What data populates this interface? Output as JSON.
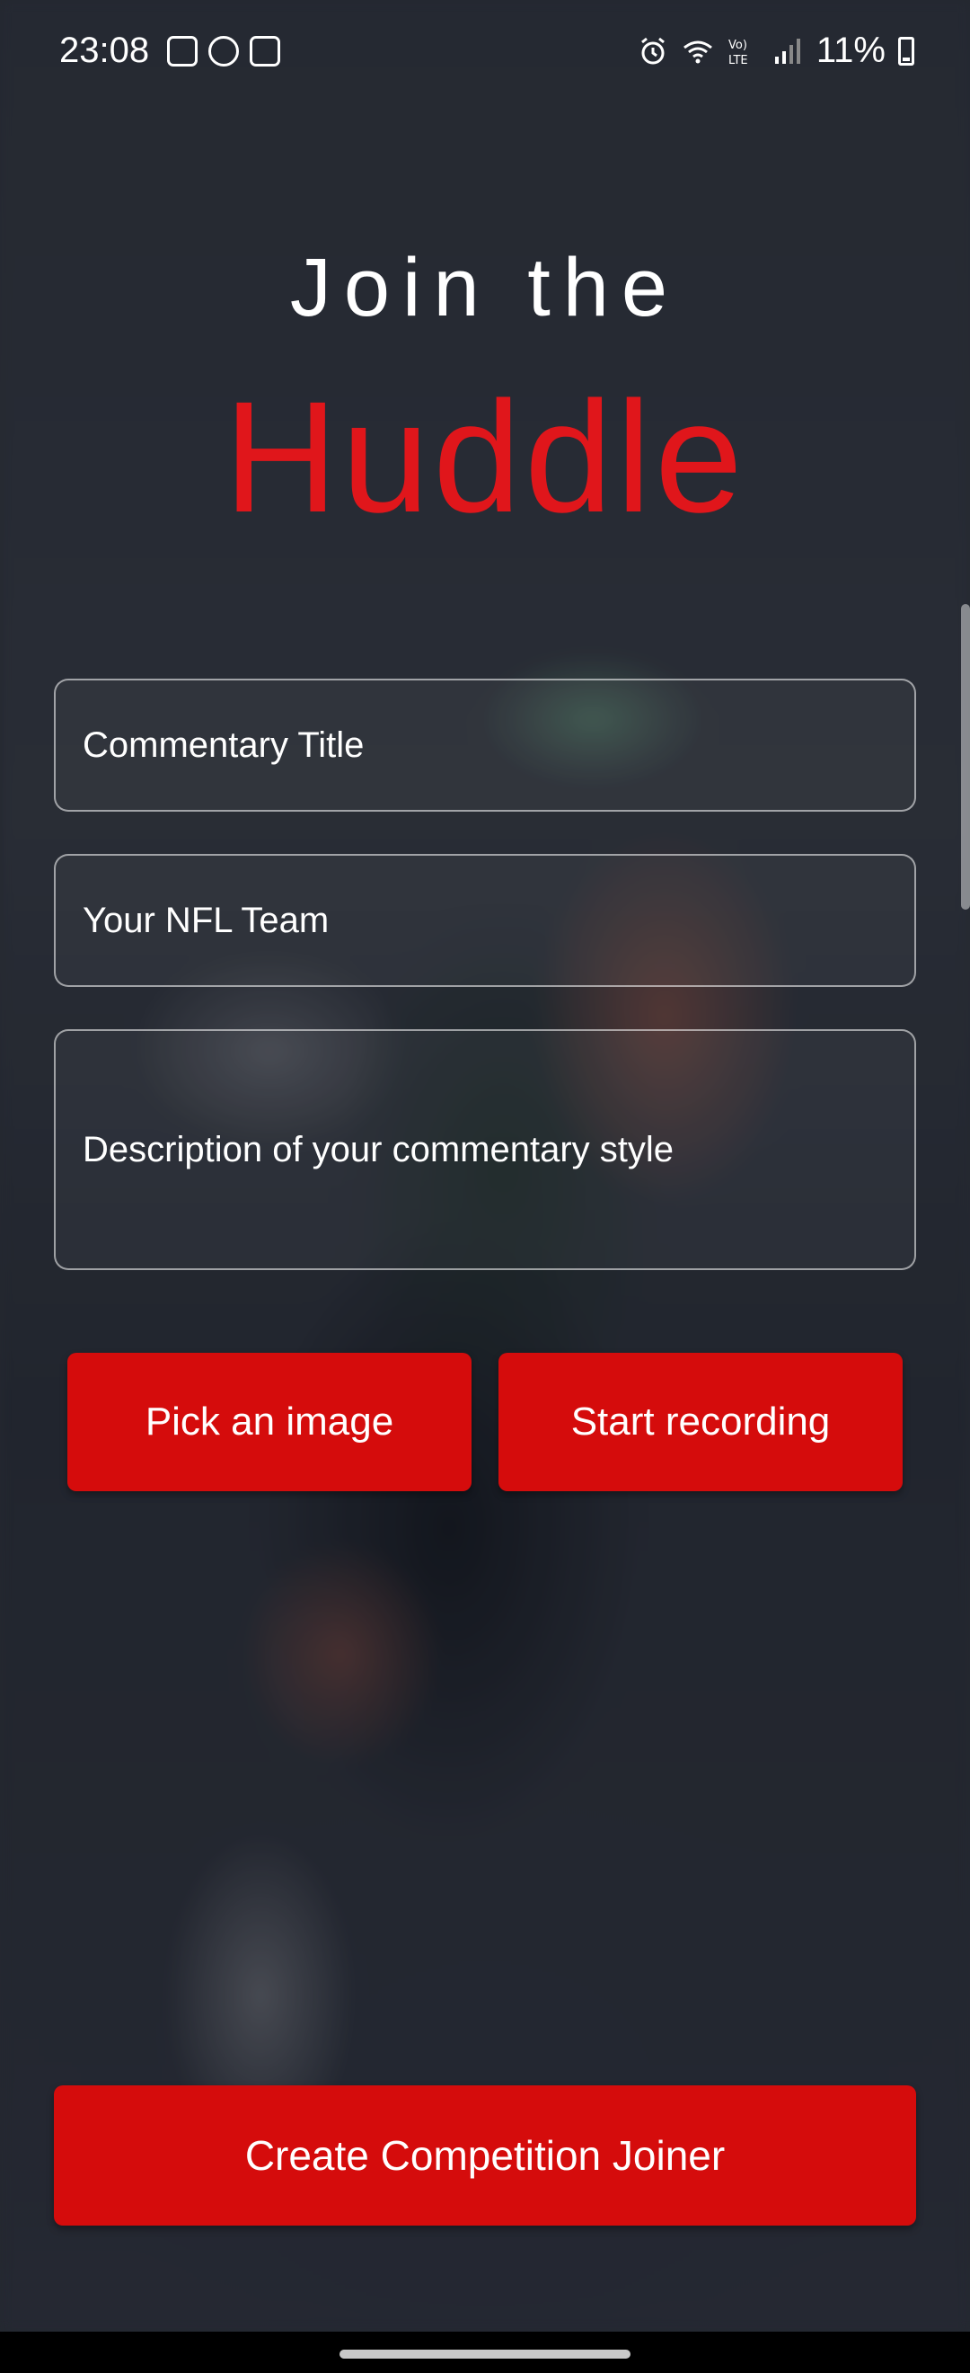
{
  "status_bar": {
    "time": "23:08",
    "battery_percent": "11%",
    "left_icons": [
      "screenshot-icon",
      "sync-icon",
      "screen-record-icon"
    ],
    "right_icons": [
      "alarm-icon",
      "wifi-icon",
      "volte-icon",
      "signal-icon",
      "battery-icon"
    ]
  },
  "header": {
    "line1": "Join the",
    "line2": "Huddle"
  },
  "form": {
    "title_placeholder": "Commentary Title",
    "team_placeholder": "Your NFL Team",
    "description_placeholder": "Description of your commentary style"
  },
  "actions": {
    "pick_image_label": "Pick an image",
    "start_recording_label": "Start recording",
    "create_label": "Create Competition Joiner"
  },
  "colors": {
    "accent": "#d50c0c",
    "title_red": "#e0161b",
    "background": "#2a2e36"
  }
}
